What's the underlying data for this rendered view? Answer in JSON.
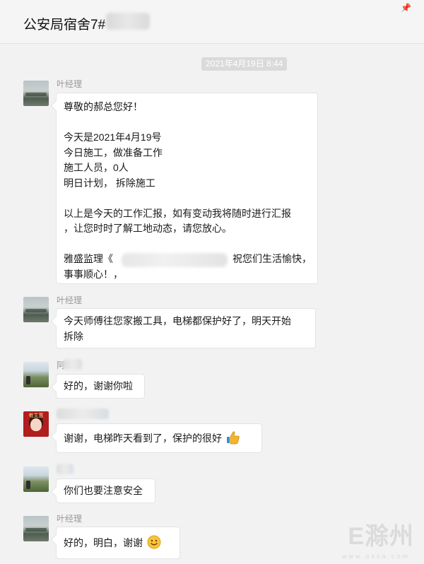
{
  "header": {
    "title": "公安局宿舍7#",
    "pin_icon": "pin-icon"
  },
  "timestamp": "2021年4月19日 8:44",
  "messages": [
    {
      "sender": "叶经理",
      "lines": [
        "尊敬的郝总您好！",
        "",
        "今天是2021年4月19号",
        "今日施工，做准备工作",
        "施工人员，0人",
        "明日计划， 拆除施工",
        "",
        "以上是今天的工作汇报，如有变动我将随时进行汇报",
        "，让您时时了解工地动态，请您放心。",
        "",
        "雅盛监理《",
        "事事顺心！，"
      ],
      "line_11_suffix": "祝您们生活愉快，"
    },
    {
      "sender": "叶经理",
      "lines": [
        "今天师傅往您家搬工具，电梯都保护好了，明天开始",
        "拆除"
      ]
    },
    {
      "sender": "阿",
      "text": "好的，谢谢你啦"
    },
    {
      "avatar_label": "有主意",
      "text": "谢谢，电梯昨天看到了，保护的很好",
      "emoji": "thumbs-up-icon"
    },
    {
      "text": "你们也要注意安全"
    },
    {
      "sender": "叶经理",
      "text": "好的，明白，谢谢",
      "emoji": "smile-icon"
    }
  ],
  "watermark": {
    "main": "E滁州",
    "sub": "www.ossa.com"
  }
}
